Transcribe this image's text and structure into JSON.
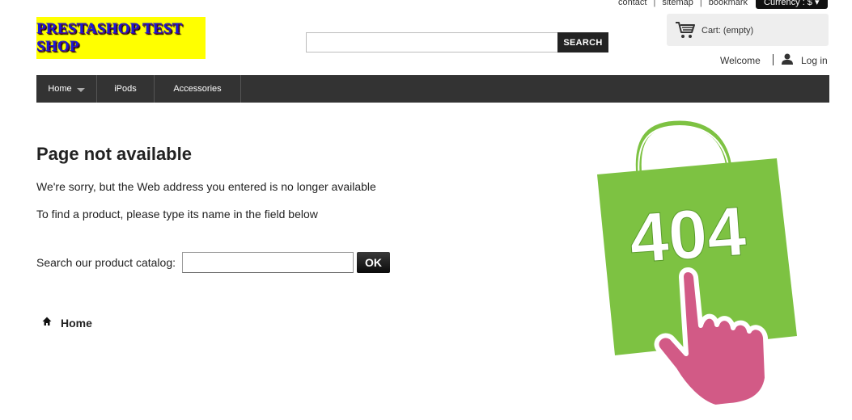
{
  "topnav": {
    "contact": "contact",
    "sitemap": "sitemap",
    "bookmark": "bookmark",
    "sep": "|",
    "currency": "Currency : $"
  },
  "logo": {
    "text": "PRESTASHOP TEST SHOP"
  },
  "search": {
    "value": "",
    "placeholder": "",
    "button": "SEARCH"
  },
  "cart": {
    "label": "Cart: (empty)"
  },
  "account": {
    "welcome": "Welcome",
    "login": "Log in"
  },
  "menu": {
    "items": [
      {
        "label": "Home",
        "has_dropdown": true
      },
      {
        "label": "iPods",
        "has_dropdown": false
      },
      {
        "label": "Accessories",
        "has_dropdown": false
      }
    ]
  },
  "content": {
    "title": "Page not available",
    "sorry": "We're sorry, but the Web address you entered is no longer available",
    "hint": "To find a product, please type its name in the field below",
    "catalog_label": "Search our product catalog:",
    "catalog_value": "",
    "ok": "OK",
    "home_link": "Home"
  },
  "illustration": {
    "code": "404",
    "bag_color": "#7dc242",
    "hand_color": "#d25a86"
  },
  "icons": [
    "cart-icon",
    "user-icon",
    "home-icon",
    "chevron-down-icon",
    "shopping-bag-404-icon",
    "pointing-hand-icon"
  ],
  "colors": {
    "menubar": "#333333",
    "logo_bg": "#ffff00",
    "logo_text": "#1a1ad6"
  }
}
